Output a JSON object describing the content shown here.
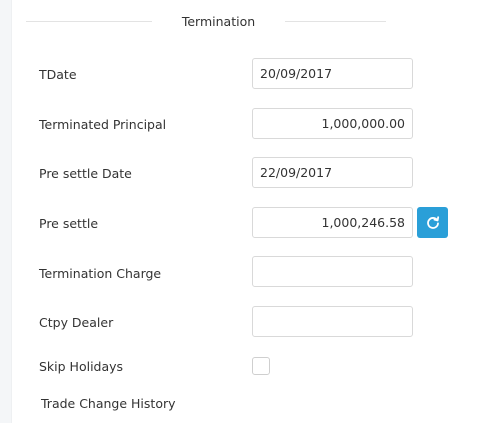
{
  "section": {
    "title": "Termination"
  },
  "fields": {
    "tdate": {
      "label": "TDate",
      "value": "20/09/2017"
    },
    "terminated_principal": {
      "label": "Terminated Principal",
      "value": "1,000,000.00"
    },
    "pre_settle_date": {
      "label": "Pre settle Date",
      "value": "22/09/2017"
    },
    "pre_settle": {
      "label": "Pre settle",
      "value": "1,000,246.58"
    },
    "termination_charge": {
      "label": "Termination Charge",
      "value": ""
    },
    "ctpy_dealer": {
      "label": "Ctpy Dealer",
      "value": ""
    },
    "skip_holidays": {
      "label": "Skip Holidays",
      "checked": false
    }
  },
  "trade_change_history": {
    "label": "Trade Change History"
  },
  "icons": {
    "refresh": "refresh-icon"
  },
  "colors": {
    "accent": "#2a9fd8",
    "border": "#d9d9d9",
    "text": "#333333"
  }
}
